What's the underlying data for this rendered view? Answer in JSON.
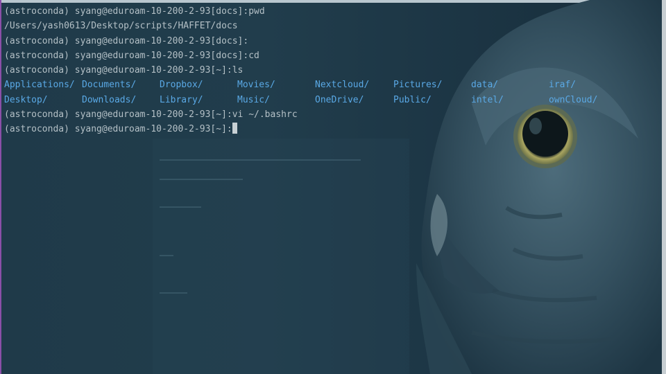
{
  "terminal": {
    "lines": [
      "(astroconda) syang@eduroam-10-200-2-93[docs]:pwd",
      "/Users/yash0613/Desktop/scripts/HAFFET/docs",
      "(astroconda) syang@eduroam-10-200-2-93[docs]:",
      "(astroconda) syang@eduroam-10-200-2-93[docs]:cd",
      "(astroconda) syang@eduroam-10-200-2-93[~]:ls"
    ],
    "ls_rows": [
      [
        "Applications/",
        "Documents/",
        "Dropbox/",
        "Movies/",
        "Nextcloud/",
        "Pictures/",
        "data/",
        "iraf/"
      ],
      [
        "Desktop/",
        "Downloads/",
        "Library/",
        "Music/",
        "OneDrive/",
        "Public/",
        "intel/",
        "ownCloud/"
      ]
    ],
    "after_lines": [
      "(astroconda) syang@eduroam-10-200-2-93[~]:vi ~/.bashrc"
    ],
    "prompt": "(astroconda) syang@eduroam-10-200-2-93[~]:"
  },
  "colors": {
    "background": "#1f3a49",
    "text": "#b4c0c6",
    "directory": "#5aa9e6",
    "cursor": "#c7d0d4"
  },
  "background_image": "owl-illustration"
}
